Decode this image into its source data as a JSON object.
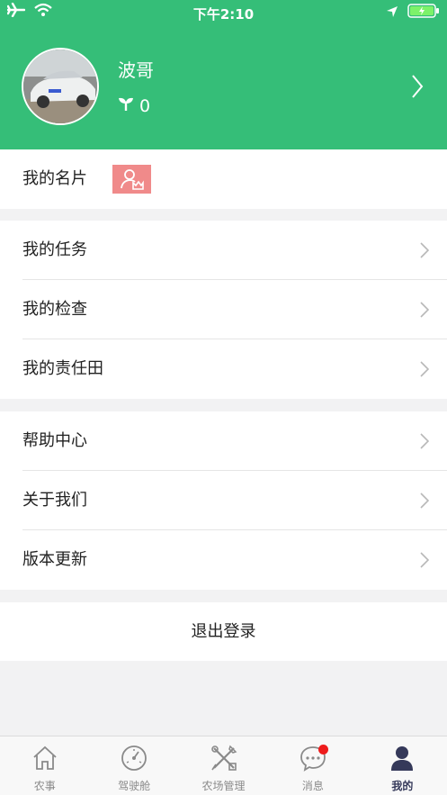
{
  "status_bar": {
    "time": "下午2:10"
  },
  "profile": {
    "name": "波哥",
    "points": "0"
  },
  "card_row": {
    "label": "我的名片"
  },
  "group1": [
    {
      "label": "我的任务"
    },
    {
      "label": "我的检查"
    },
    {
      "label": "我的责任田"
    }
  ],
  "group2": [
    {
      "label": "帮助中心"
    },
    {
      "label": "关于我们"
    },
    {
      "label": "版本更新"
    }
  ],
  "logout": {
    "label": "退出登录"
  },
  "tabs": [
    {
      "label": "农事",
      "icon": "home-icon"
    },
    {
      "label": "驾驶舱",
      "icon": "dashboard-icon"
    },
    {
      "label": "农场管理",
      "icon": "tools-icon"
    },
    {
      "label": "消息",
      "icon": "message-icon"
    },
    {
      "label": "我的",
      "icon": "user-icon"
    }
  ],
  "colors": {
    "brand": "#35be78",
    "badge": "#f08a8a",
    "active_tab": "#35395a",
    "notify": "#ee1c1c"
  }
}
